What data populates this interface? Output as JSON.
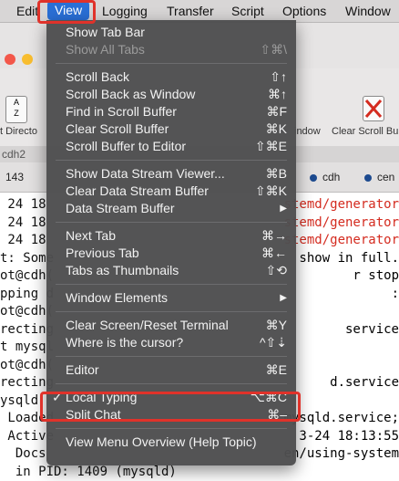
{
  "menubar": {
    "items": [
      "Edit",
      "View",
      "Logging",
      "Transfer",
      "Script",
      "Options",
      "Window"
    ],
    "active": "View"
  },
  "toolbar": {
    "left_label": "t Directo",
    "mid_label": "indow",
    "right_label": "Clear Scroll Bu"
  },
  "tabs": {
    "session_tab": "cdh2",
    "row_left": "143",
    "row_mid": "cdh",
    "row_right": "cen"
  },
  "terminal": {
    "left_lines": [
      " 24 18",
      " 24 18",
      " 24 18",
      "t: Some",
      "ot@cdh(",
      "pping d",
      "ot@cdh(",
      "recting",
      "t mysql",
      "ot@cdh(",
      "recting",
      "ysqld",
      " Loaded",
      " Active",
      "  Docs",
      "  in PID: 1409 (mysqld)"
    ],
    "right_lines": [
      {
        "text": "stemd/generator",
        "color": "red"
      },
      {
        "text": "stemd/generator",
        "color": "red"
      },
      {
        "text": "stemd/generator",
        "color": "red"
      },
      {
        "text": "show in full.",
        "color": "normal"
      },
      {
        "text": "r stop",
        "color": "normal"
      },
      {
        "text": ":",
        "color": "normal"
      },
      {
        "text": "",
        "color": "normal"
      },
      {
        "text": "service",
        "color": "normal"
      },
      {
        "text": "",
        "color": "normal"
      },
      {
        "text": "",
        "color": "normal"
      },
      {
        "text": "d.service",
        "color": "normal"
      },
      {
        "text": "",
        "color": "normal"
      },
      {
        "text": "mysqld.service;",
        "color": "normal"
      },
      {
        "text": "3-24 18:13:55",
        "color": "normal"
      },
      {
        "text": "en/using-system",
        "color": "normal"
      }
    ]
  },
  "view_menu": {
    "groups": [
      [
        {
          "label": "Show Tab Bar",
          "shortcut": "",
          "enabled": true
        },
        {
          "label": "Show All Tabs",
          "shortcut": "⇧⌘\\",
          "enabled": false
        }
      ],
      [
        {
          "label": "Scroll Back",
          "shortcut": "⇧↑",
          "enabled": true
        },
        {
          "label": "Scroll Back as Window",
          "shortcut": "⌘↑",
          "enabled": true
        },
        {
          "label": "Find in Scroll Buffer",
          "shortcut": "⌘F",
          "enabled": true
        },
        {
          "label": "Clear Scroll Buffer",
          "shortcut": "⌘K",
          "enabled": true
        },
        {
          "label": "Scroll Buffer to Editor",
          "shortcut": "⇧⌘E",
          "enabled": true
        }
      ],
      [
        {
          "label": "Show Data Stream Viewer...",
          "shortcut": "⌘B",
          "enabled": true
        },
        {
          "label": "Clear Data Stream Buffer",
          "shortcut": "⇧⌘K",
          "enabled": true
        },
        {
          "label": "Data Stream Buffer",
          "shortcut": "▶",
          "enabled": true
        }
      ],
      [
        {
          "label": "Next Tab",
          "shortcut": "⌘→",
          "enabled": true
        },
        {
          "label": "Previous Tab",
          "shortcut": "⌘←",
          "enabled": true
        },
        {
          "label": "Tabs as Thumbnails",
          "shortcut": "⇧⟲",
          "enabled": true
        }
      ],
      [
        {
          "label": "Window Elements",
          "shortcut": "▶",
          "enabled": true
        }
      ],
      [
        {
          "label": "Clear Screen/Reset Terminal",
          "shortcut": "⌘Y",
          "enabled": true
        },
        {
          "label": "Where is the cursor?",
          "shortcut": "^⇧⇣",
          "enabled": true
        }
      ],
      [
        {
          "label": "Editor",
          "shortcut": "⌘E",
          "enabled": true
        }
      ],
      [
        {
          "label": "Local Typing",
          "shortcut": "⌥⌘C",
          "enabled": true,
          "checked": true
        },
        {
          "label": "Split Chat",
          "shortcut": "⌘–",
          "enabled": true
        }
      ],
      [
        {
          "label": "View Menu Overview (Help Topic)",
          "shortcut": "",
          "enabled": true
        }
      ]
    ],
    "check_mark": "✓"
  },
  "colors": {
    "highlight_box": "#e0322a",
    "menu_bg": "#4e4e50",
    "active_menu": "#2a6fd6",
    "terminal_red": "#d42b1f"
  }
}
